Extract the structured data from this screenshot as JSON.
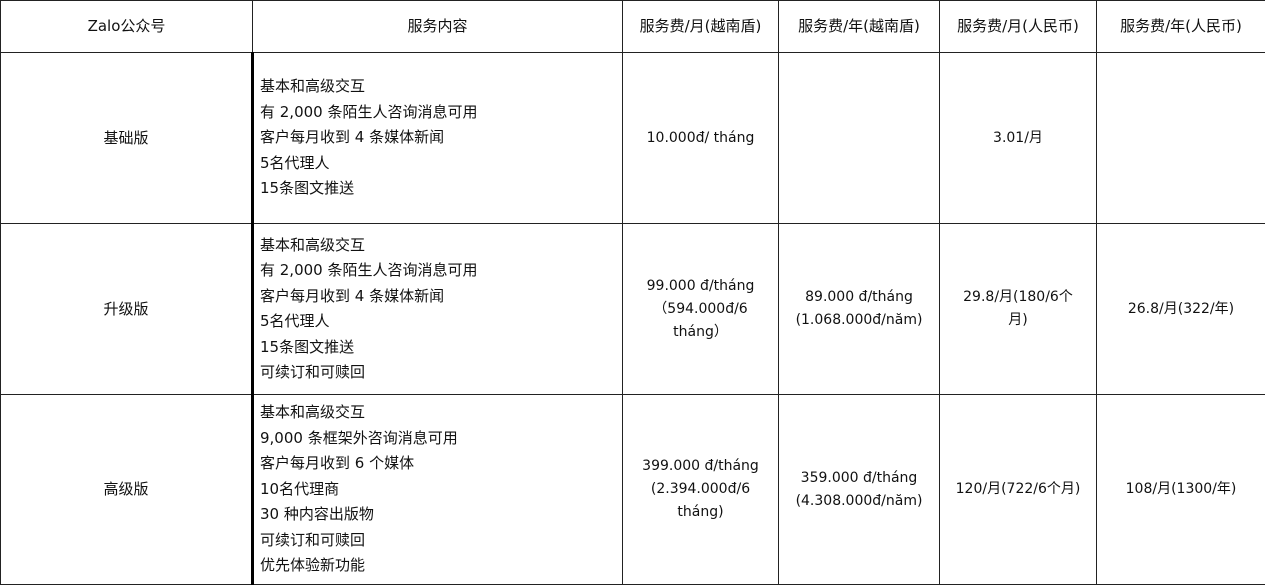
{
  "headers": [
    "Zalo公众号",
    "服务内容",
    "服务费/月(越南盾)",
    "服务费/年(越南盾)",
    "服务费/月(人民币)",
    "服务费/年(人民币)"
  ],
  "rows": [
    {
      "plan": "基础版",
      "features": [
        "基本和高级交互",
        "有 2,000 条陌生人咨询消息可用",
        "客户每月收到 4 条媒体新闻",
        "5名代理人",
        "15条图文推送"
      ],
      "monthly_vnd": [
        "10.000đ/ tháng"
      ],
      "yearly_vnd": [],
      "monthly_cny": [
        "3.01/月"
      ],
      "yearly_cny": []
    },
    {
      "plan": "升级版",
      "features": [
        "基本和高级交互",
        "有 2,000 条陌生人咨询消息可用",
        "客户每月收到 4 条媒体新闻",
        "5名代理人",
        "15条图文推送",
        "可续订和可赎回"
      ],
      "monthly_vnd": [
        "99.000 đ/tháng",
        "（594.000đ/6",
        "tháng）"
      ],
      "yearly_vnd": [
        "89.000 đ/tháng",
        "(1.068.000đ/năm)"
      ],
      "monthly_cny": [
        "29.8/月(180/6个",
        "月)"
      ],
      "yearly_cny": [
        "26.8/月(322/年)"
      ]
    },
    {
      "plan": "高级版",
      "features": [
        "基本和高级交互",
        "9,000 条框架外咨询消息可用",
        "客户每月收到 6 个媒体",
        "10名代理商",
        "30 种内容出版物",
        "可续订和可赎回",
        "优先体验新功能"
      ],
      "monthly_vnd": [
        "399.000 đ/tháng",
        "(2.394.000đ/6",
        "tháng)"
      ],
      "yearly_vnd": [
        "359.000 đ/tháng",
        "(4.308.000đ/năm)"
      ],
      "monthly_cny": [
        "120/月(722/6个月)"
      ],
      "yearly_cny": [
        "108/月(1300/年)"
      ]
    }
  ]
}
